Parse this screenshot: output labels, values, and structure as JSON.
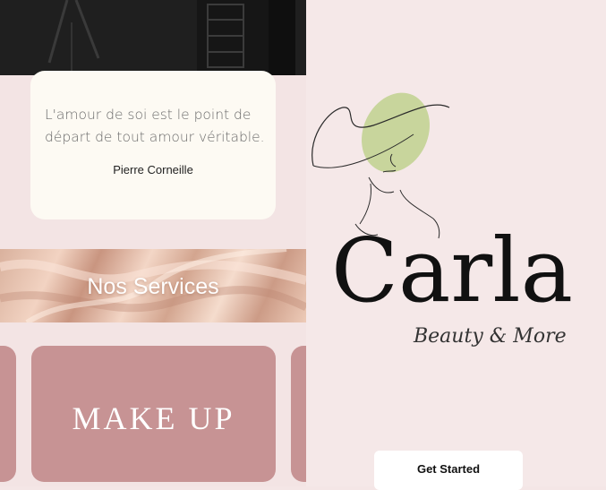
{
  "quote": {
    "text_line1": "L'amour de soi est le point de",
    "text_line2": "départ de tout amour véritable.",
    "author": "Pierre Corneille"
  },
  "services": {
    "title": "Nos Services",
    "main_card_label": "MAKE UP"
  },
  "brand": {
    "name": "Carla",
    "tagline": "Beauty & More",
    "face_accent_color": "#c8d59c",
    "card_color": "#c79394"
  },
  "onboarding": {
    "cta_label": "Get Started"
  }
}
